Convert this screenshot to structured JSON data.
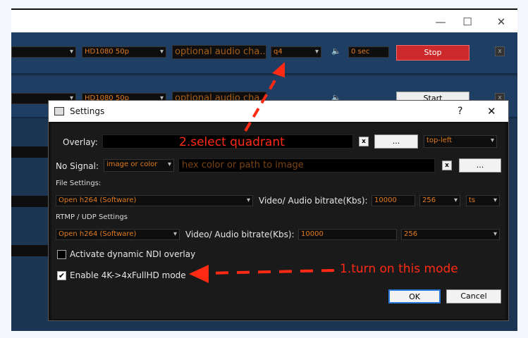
{
  "window": {
    "min": "—",
    "max": "☐",
    "close": "✕"
  },
  "rows": [
    {
      "format": "HD1080 50p",
      "audio": "optional audio cha...",
      "quadrant": "q4",
      "delay": "0 sec",
      "action": "Stop"
    },
    {
      "format": "HD1080 50p",
      "audio": "optional audio cha...",
      "action": "Start"
    }
  ],
  "dialog": {
    "title": "Settings",
    "help": "?",
    "close": "✕",
    "overlay_label": "Overlay:",
    "overlay_position": "top-left",
    "browse": "...",
    "clear": "x",
    "nosignal_label": "No Signal:",
    "nosignal_mode": "image or color",
    "nosignal_placeholder": "hex color or path to image",
    "file_settings": "File Settings:",
    "file_codec": "Open h264 (Software)",
    "file_bitrate_label": "Video/ Audio bitrate(Kbs):",
    "file_video_bitrate": "10000",
    "file_audio_bitrate": "256",
    "file_container": "ts",
    "rtmp_settings": "RTMP / UDP Settings",
    "rtmp_codec": "Open h264 (Software)",
    "rtmp_bitrate_label": "Video/ Audio bitrate(Kbs):",
    "rtmp_video_bitrate": "10000",
    "rtmp_audio_bitrate": "256",
    "ndi_label": "Activate dynamic NDI overlay",
    "ndi_checked": false,
    "mode_label": "Enable 4K->4xFullHD mode",
    "mode_checked": true,
    "ok": "OK",
    "cancel": "Cancel"
  },
  "annotations": {
    "step2": "2.select quadrant",
    "step1": "1.turn on this mode"
  },
  "colors": {
    "annotation": "#ff2a14",
    "stop_button": "#cc2a2a",
    "input_text": "#e07a1e"
  }
}
